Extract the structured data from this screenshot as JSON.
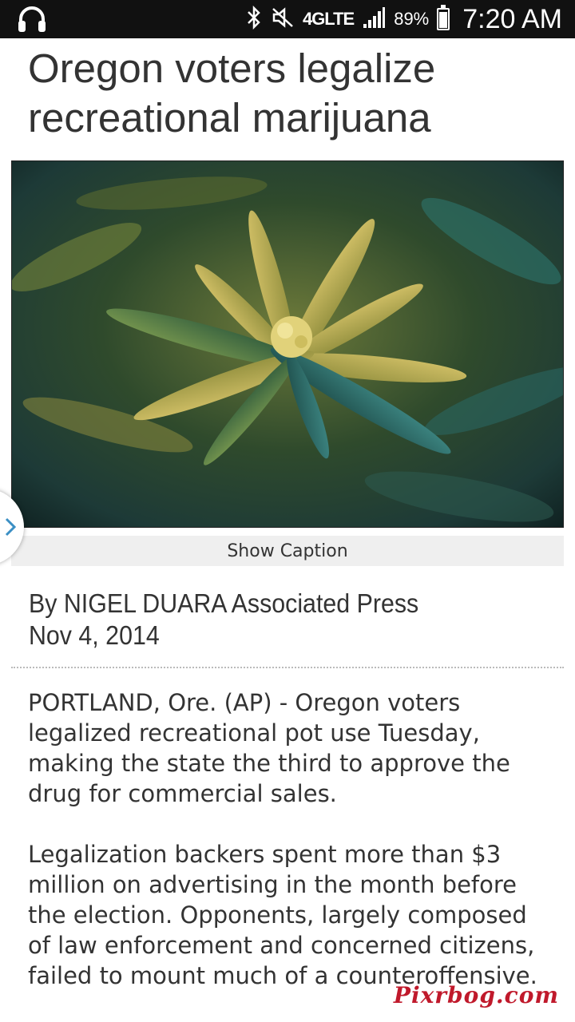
{
  "status_bar": {
    "network": "4GLTE",
    "battery": "89%",
    "battery_level": 0.89,
    "time": "7:20 AM",
    "icons": [
      "headphones-icon",
      "bluetooth-icon",
      "mute-icon",
      "signal-icon",
      "battery-icon"
    ]
  },
  "article": {
    "title": "Oregon voters legalize recreational marijuana",
    "show_caption": "Show Caption",
    "byline": "By NIGEL DUARA Associated Press",
    "date": "Nov 4, 2014",
    "paragraphs": [
      "PORTLAND, Ore. (AP) - Oregon voters legalized recreational pot use Tuesday, making the state the third to approve the drug for commercial sales.",
      "Legalization backers spent more than $3 million on advertising in the month before the election. Opponents, largely composed of law enforcement and concerned citizens, failed to mount much of a counteroffensive."
    ]
  },
  "watermark": "Pixrbog.com"
}
